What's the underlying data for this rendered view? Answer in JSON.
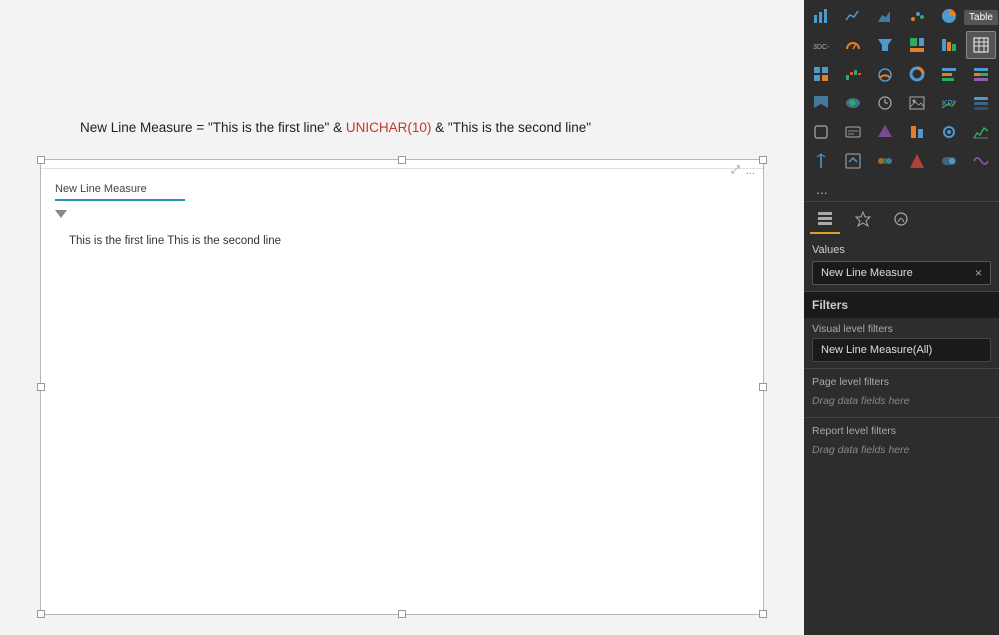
{
  "formula": {
    "measure_name": "New Line Measure",
    "equals": " = ",
    "part1": "\"This is the first line\"",
    "ampersand1": " & ",
    "unichar": "UNICHAR(10)",
    "ampersand2": " & ",
    "part2": "\"This is the second line\""
  },
  "visual": {
    "title": "New Line Measure",
    "content_line1": "This is the first line This is the second line",
    "tooltip": "Table",
    "expand_icon": "⤢",
    "more_icon": "..."
  },
  "panel_tabs": [
    {
      "id": "fields",
      "label": "Fields",
      "active": true
    },
    {
      "id": "format",
      "label": "Format",
      "active": false
    },
    {
      "id": "analytics",
      "label": "Analytics",
      "active": false
    }
  ],
  "fields_section": {
    "label": "Values",
    "field": "New Line Measure",
    "close_label": "×"
  },
  "filters": {
    "header": "Filters",
    "visual_level_label": "Visual level filters",
    "visual_field": "New Line Measure(All)",
    "page_level_label": "Page level filters",
    "page_drag": "Drag data fields here",
    "report_level_label": "Report level filters",
    "report_drag": "Drag data fields here"
  },
  "icons": {
    "rows": [
      [
        "bar-chart",
        "line-chart",
        "area-chart",
        "scatter-chart",
        "pie-chart",
        "R-icon"
      ],
      [
        "gauge",
        "map-bubble",
        "funnel",
        "treemap",
        "bar-chart-2",
        "table-icon"
      ],
      [
        "matrix",
        "waterfall",
        "gauge-2",
        "donut",
        "stacked-bar",
        "100pct-bar"
      ],
      [
        "ribbon",
        "filled-map",
        "clock",
        "image",
        "kpi",
        "slicer"
      ],
      [
        "shape",
        "text-box",
        "custom1",
        "custom2",
        "custom3",
        "custom4"
      ],
      [
        "custom5",
        "custom6",
        "custom7",
        "custom8",
        "custom9",
        "custom10"
      ]
    ],
    "more_label": "..."
  },
  "colors": {
    "accent_red": "#c0392b",
    "panel_bg": "#2d2d2d",
    "panel_dark": "#1a1a1a",
    "border_color": "#555",
    "active_tab": "#d9a02b"
  }
}
